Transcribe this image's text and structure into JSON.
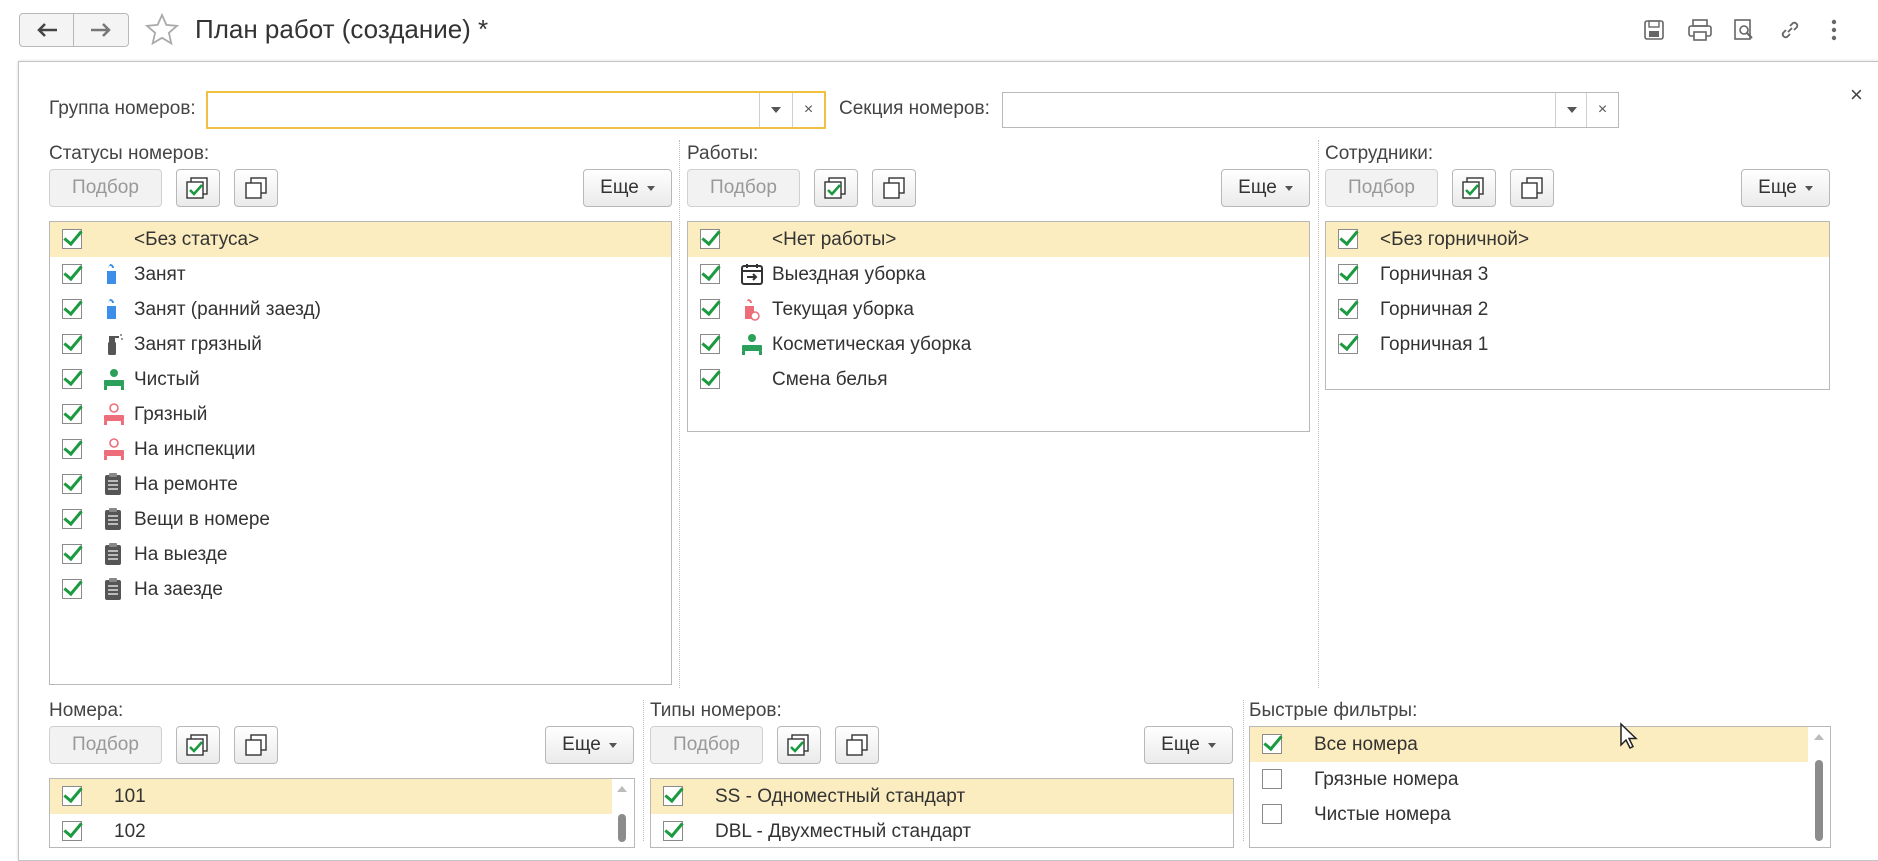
{
  "window": {
    "title": "План работ (создание) *"
  },
  "filters": {
    "group_label": "Группа номеров:",
    "group_value": "",
    "section_label": "Секция номеров:",
    "section_value": "",
    "clear_glyph": "×",
    "close_glyph": "×"
  },
  "buttons": {
    "pick": "Подбор",
    "more": "Еще"
  },
  "statuses": {
    "label": "Статусы номеров:",
    "items": [
      {
        "text": "<Без статуса>",
        "checked": true,
        "icon": ""
      },
      {
        "text": "Занят",
        "checked": true,
        "icon": "door-hanger-blue-icon"
      },
      {
        "text": "Занят (ранний заезд)",
        "checked": true,
        "icon": "door-hanger-blue-icon"
      },
      {
        "text": "Занят грязный",
        "checked": true,
        "icon": "spray-bottle-icon"
      },
      {
        "text": "Чистый",
        "checked": true,
        "icon": "bed-green-icon"
      },
      {
        "text": "Грязный",
        "checked": true,
        "icon": "bed-red-icon"
      },
      {
        "text": "На инспекции",
        "checked": true,
        "icon": "bed-red-icon"
      },
      {
        "text": "На ремонте",
        "checked": true,
        "icon": "clipboard-icon"
      },
      {
        "text": "Вещи в номере",
        "checked": true,
        "icon": "clipboard-icon"
      },
      {
        "text": "На выезде",
        "checked": true,
        "icon": "clipboard-icon"
      },
      {
        "text": "На заезде",
        "checked": true,
        "icon": "clipboard-icon"
      }
    ]
  },
  "works": {
    "label": "Работы:",
    "items": [
      {
        "text": "<Нет работы>",
        "checked": true,
        "icon": ""
      },
      {
        "text": "Выездная уборка",
        "checked": true,
        "icon": "calendar-exit-icon"
      },
      {
        "text": "Текущая уборка",
        "checked": true,
        "icon": "door-hanger-red-icon"
      },
      {
        "text": "Косметическая уборка",
        "checked": true,
        "icon": "bed-green-icon"
      },
      {
        "text": "Смена белья",
        "checked": true,
        "icon": ""
      }
    ]
  },
  "staff": {
    "label": "Сотрудники:",
    "items": [
      {
        "text": "<Без горничной>",
        "checked": true
      },
      {
        "text": "Горничная 3",
        "checked": true
      },
      {
        "text": "Горничная 2",
        "checked": true
      },
      {
        "text": "Горничная 1",
        "checked": true
      }
    ]
  },
  "rooms": {
    "label": "Номера:",
    "items": [
      {
        "text": "101",
        "checked": true
      },
      {
        "text": "102",
        "checked": true
      }
    ]
  },
  "room_types": {
    "label": "Типы номеров:",
    "items": [
      {
        "text": "SS - Одноместный стандарт",
        "checked": true
      },
      {
        "text": "DBL - Двухместный стандарт",
        "checked": true
      }
    ]
  },
  "quick_filters": {
    "label": "Быстрые фильтры:",
    "items": [
      {
        "text": "Все номера",
        "checked": true
      },
      {
        "text": "Грязные номера",
        "checked": false
      },
      {
        "text": "Чистые номера",
        "checked": false
      }
    ]
  },
  "colors": {
    "accent": "#f2c040",
    "selected_row": "#fbedbf",
    "check": "#1b9a40"
  }
}
